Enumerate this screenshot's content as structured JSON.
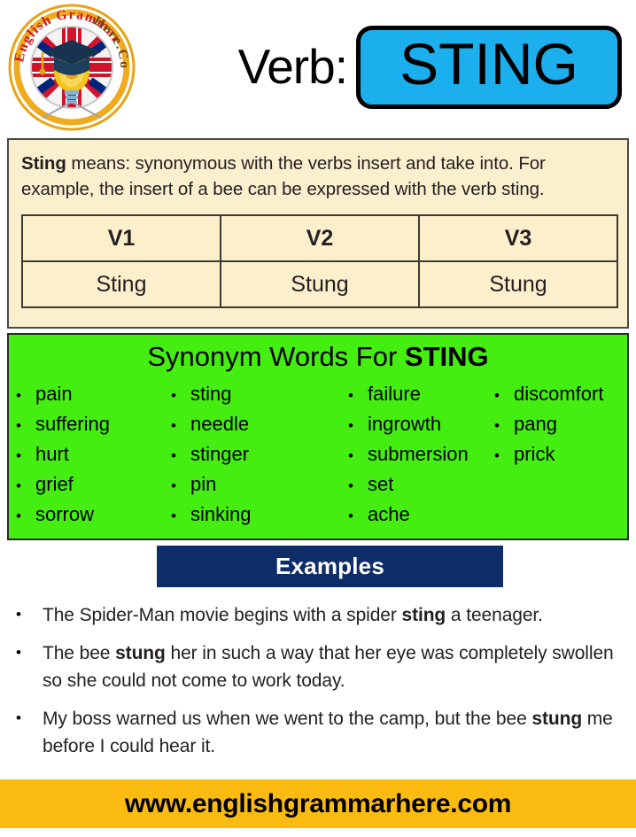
{
  "header": {
    "logo_alt": "English Grammar Here.Com",
    "logo_text_top": "English Grammar",
    "logo_text_bottom": "Here.Com",
    "verb_label": "Verb:",
    "verb_value": "STING"
  },
  "definition": {
    "term": "Sting",
    "rest": " means:  synonymous with the verbs insert and take into. For example, the insert of a bee can be expressed with the verb sting."
  },
  "verb_table": {
    "headers": [
      "V1",
      "V2",
      "V3"
    ],
    "values": [
      "Sting",
      "Stung",
      "Stung"
    ]
  },
  "synonyms": {
    "title_prefix": "Synonym Words For ",
    "title_word": "STING",
    "columns": [
      [
        "pain",
        "suffering",
        "hurt",
        "grief",
        "sorrow"
      ],
      [
        "sting",
        "needle",
        "stinger",
        "pin",
        "sinking"
      ],
      [
        "failure",
        "ingrowth",
        "submersion",
        "set",
        "ache"
      ],
      [
        "discomfort",
        "pang",
        "prick"
      ]
    ],
    "bullet": "•"
  },
  "examples": {
    "heading": "Examples",
    "bullet": "•",
    "items": [
      {
        "pre": "The Spider-Man movie begins with a spider ",
        "bold": "sting",
        "post": " a teenager."
      },
      {
        "pre": "The bee ",
        "bold": "stung",
        "post": " her in such a way that her eye was completely swollen so she could not come to work today."
      },
      {
        "pre": "My boss warned us when we went to the camp, but the bee ",
        "bold": "stung",
        "post": " me before I could hear it."
      }
    ]
  },
  "footer": {
    "url": "www.englishgrammarhere.com"
  },
  "colors": {
    "verb_box": "#1BAFEE",
    "cream_panel": "#FBF0CE",
    "green_panel": "#44EE11",
    "examples_header": "#0E2C67",
    "footer_bar": "#FBBB10"
  }
}
